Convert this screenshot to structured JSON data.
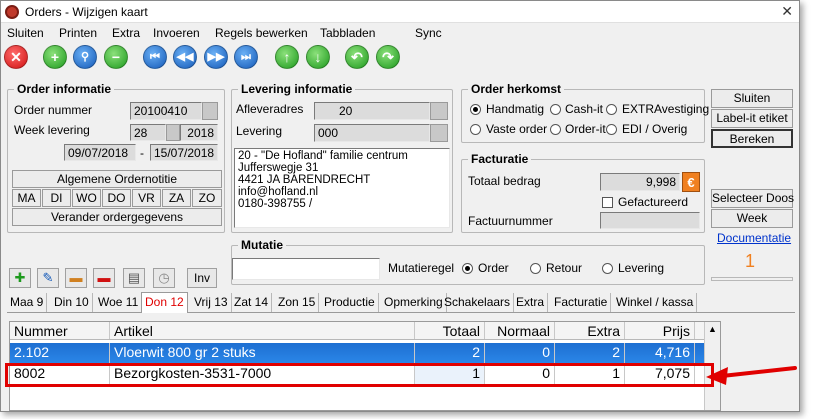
{
  "window": {
    "title": "Orders - Wijzigen kaart",
    "close": "✕"
  },
  "menu": [
    "Sluiten",
    "Printen",
    "Extra",
    "Invoeren",
    "Regels bewerken",
    "Tabbladen",
    "Sync"
  ],
  "toolbar": {
    "buttons": [
      {
        "icon": "close-icon",
        "glyph": "✕",
        "color": "#d01010"
      },
      {
        "icon": "add-icon",
        "glyph": "+",
        "color": "#1d9a1d"
      },
      {
        "icon": "search-icon",
        "glyph": "⚲",
        "color": "#1459b8"
      },
      {
        "icon": "remove-icon",
        "glyph": "−",
        "color": "#1d9a1d"
      },
      {
        "icon": "first-icon",
        "glyph": "⏮",
        "color": "#1459b8"
      },
      {
        "icon": "previous-icon",
        "glyph": "◀◀",
        "color": "#1459b8"
      },
      {
        "icon": "next-icon",
        "glyph": "▶▶",
        "color": "#1459b8"
      },
      {
        "icon": "last-icon",
        "glyph": "⏭",
        "color": "#1459b8"
      },
      {
        "icon": "arrow-up-icon",
        "glyph": "↑",
        "color": "#1d9a1d"
      },
      {
        "icon": "arrow-down-icon",
        "glyph": "↓",
        "color": "#1d9a1d"
      },
      {
        "icon": "undo-icon",
        "glyph": "↶",
        "color": "#1d9a1d"
      },
      {
        "icon": "redo-icon",
        "glyph": "↷",
        "color": "#1d9a1d"
      }
    ]
  },
  "order_info": {
    "legend": "Order informatie",
    "order_nummer_label": "Order nummer",
    "order_nummer": "20100410",
    "week_label": "Week levering",
    "week": "28",
    "year": "2018",
    "date_from": "09/07/2018",
    "date_sep": "-",
    "date_to": "15/07/2018",
    "algemene": "Algemene Ordernotitie",
    "days": [
      "MA",
      "DI",
      "WO",
      "DO",
      "VR",
      "ZA",
      "ZO"
    ],
    "verander": "Verander ordergegevens"
  },
  "levering": {
    "legend": "Levering informatie",
    "afleveradres_label": "Afleveradres",
    "afleveradres": "20",
    "levering_label": "Levering",
    "levering": "000",
    "address": [
      "20 - \"De Hofland\" familie centrum",
      "Jufferswegje 31",
      "4421 JA BARENDRECHT",
      "info@hofland.nl",
      "0180-398755 /"
    ]
  },
  "herkomst": {
    "legend": "Order herkomst",
    "options": [
      "Handmatig",
      "Cash-it",
      "EXTRAvestiging",
      "Vaste order",
      "Order-it",
      "EDI / Overig"
    ],
    "selected": "Handmatig"
  },
  "facturatie": {
    "legend": "Facturatie",
    "totaal_label": "Totaal bedrag",
    "totaal": "9,998",
    "currency_symbol": "€",
    "gefactureerd": "Gefactureerd",
    "factuur_label": "Factuurnummer",
    "factuur": ""
  },
  "right_buttons": {
    "sluiten": "Sluiten",
    "labelit": "Label-it etiket",
    "bereken": "Bereken",
    "selecteer": "Selecteer Doos",
    "week": "Week",
    "documentatie": "Documentatie",
    "counter": "1"
  },
  "mutatie": {
    "legend": "Mutatie",
    "input": "",
    "regel_label": "Mutatieregel",
    "options": [
      "Order",
      "Retour",
      "Levering"
    ],
    "selected": "Order"
  },
  "iconbar": {
    "buttons": [
      "add-row-icon",
      "edit-icon",
      "folder-icon",
      "delete-row-icon",
      "notes-icon",
      "clock-icon"
    ],
    "inv": "Inv"
  },
  "tabs": [
    "Maa 9",
    "Din 10",
    "Woe 11",
    "Don 12",
    "Vrij 13",
    "Zat 14",
    "Zon 15",
    "Productie",
    "Opmerking",
    "Schakelaars",
    "Extra",
    "Facturatie",
    "Winkel / kassa"
  ],
  "active_tab": "Don 12",
  "grid": {
    "columns": [
      "Nummer",
      "Artikel",
      "Totaal",
      "Normaal",
      "Extra",
      "Prijs"
    ],
    "rows": [
      [
        "2.102",
        "Vloerwit 800 gr 2 stuks",
        "2",
        "0",
        "2",
        "4,716"
      ],
      [
        "8002",
        "Bezorgkosten-3531-7000",
        "1",
        "0",
        "1",
        "7,075"
      ]
    ],
    "selected_row": 0,
    "highlighted_row": 1
  },
  "colors": {
    "highlight": "#e00000",
    "selection": "#1e6fd1",
    "link": "#0033cc",
    "accent_counter": "#f08020"
  }
}
